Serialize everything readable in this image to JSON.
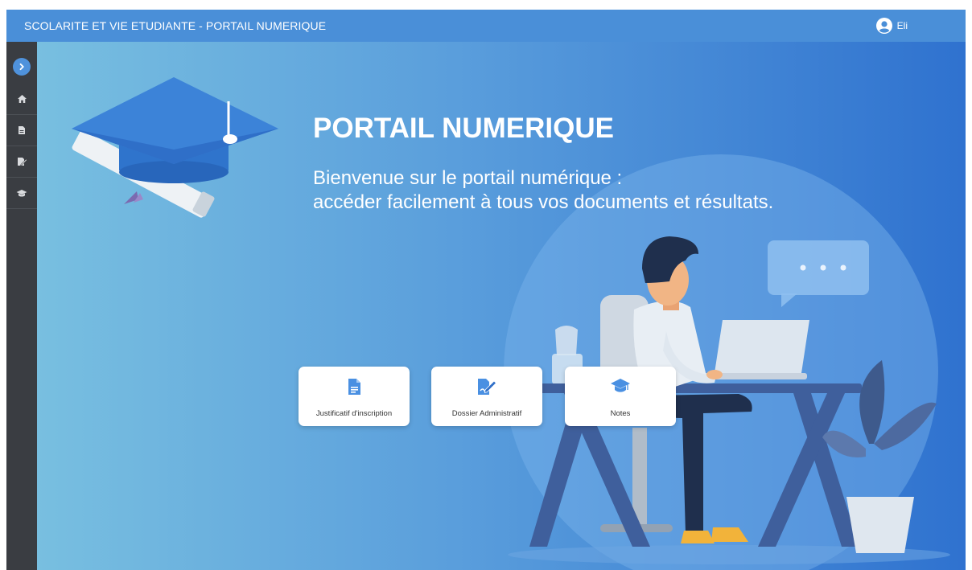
{
  "header": {
    "title": "SCOLARITE ET VIE ETUDIANTE - PORTAIL NUMERIQUE",
    "user_name": "Eli"
  },
  "sidebar": {
    "items": [
      {
        "name": "toggle",
        "icon": "chevron-right-icon"
      },
      {
        "name": "home",
        "icon": "home-icon"
      },
      {
        "name": "document",
        "icon": "document-icon"
      },
      {
        "name": "edit",
        "icon": "edit-document-icon"
      },
      {
        "name": "graduation",
        "icon": "graduation-cap-icon"
      }
    ]
  },
  "hero": {
    "title": "PORTAIL NUMERIQUE",
    "subtitle_line1": "Bienvenue sur le portail numérique :",
    "subtitle_line2": "accéder facilement à tous vos documents et résultats."
  },
  "cards": [
    {
      "label": "Justificatif d'inscription",
      "icon": "document-icon"
    },
    {
      "label": "Dossier Administratif",
      "icon": "signature-document-icon"
    },
    {
      "label": "Notes",
      "icon": "graduation-cap-icon"
    }
  ],
  "colors": {
    "topbar": "#4a8fd8",
    "sidebar": "#3a3d42",
    "accent": "#4a90e2",
    "gradient_start": "#78bfe0",
    "gradient_end": "#2f72cf"
  }
}
